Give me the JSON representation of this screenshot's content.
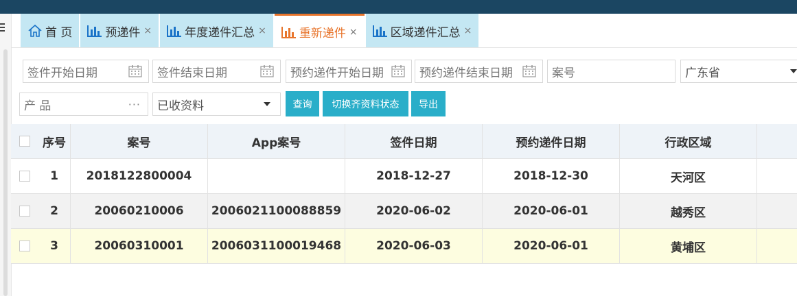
{
  "tabs": [
    {
      "label": "首 页",
      "icon": "home-icon",
      "closable": false,
      "active": false
    },
    {
      "label": "预递件",
      "icon": "bar-chart-icon",
      "closable": true,
      "active": false
    },
    {
      "label": "年度递件汇总",
      "icon": "bar-chart-icon",
      "closable": true,
      "active": false
    },
    {
      "label": "重新递件",
      "icon": "bar-chart-icon",
      "closable": true,
      "active": true
    },
    {
      "label": "区域递件汇总",
      "icon": "bar-chart-icon",
      "closable": true,
      "active": false
    }
  ],
  "close_glyph": "×",
  "filters": {
    "sign_start_placeholder": "签件开始日期",
    "sign_end_placeholder": "签件结束日期",
    "appt_start_placeholder": "预约递件开始日期",
    "appt_end_placeholder": "预约递件结束日期",
    "case_no_placeholder": "案号",
    "province_value": "广东省",
    "product_placeholder": "产 品",
    "product_more": "···",
    "material_status_value": "已收资料"
  },
  "buttons": {
    "query": "查询",
    "toggle_status": "切换齐资料状态",
    "export": "导出"
  },
  "table": {
    "headers": [
      "序号",
      "案号",
      "App案号",
      "签件日期",
      "预约递件日期",
      "行政区域"
    ],
    "rows": [
      {
        "index": "1",
        "case_no": "2018122800004",
        "app_case_no": "",
        "sign_date": "2018-12-27",
        "appt_date": "2018-12-30",
        "district": "天河区"
      },
      {
        "index": "2",
        "case_no": "20060210006",
        "app_case_no": "2006021100088859",
        "sign_date": "2020-06-02",
        "appt_date": "2020-06-01",
        "district": "越秀区"
      },
      {
        "index": "3",
        "case_no": "20060310001",
        "app_case_no": "2006031100019468",
        "sign_date": "2020-06-03",
        "appt_date": "2020-06-01",
        "district": "黄埔区"
      }
    ]
  },
  "colors": {
    "topbar": "#1b4662",
    "tab_bg": "#c4e7f3",
    "active_tab": "#e8752c",
    "accent_button": "#2aaec9",
    "icon_blue": "#1a73c8",
    "header_row": "#eef3f8",
    "row_even": "#f2f2f2",
    "row_highlight": "#fdfde0"
  }
}
